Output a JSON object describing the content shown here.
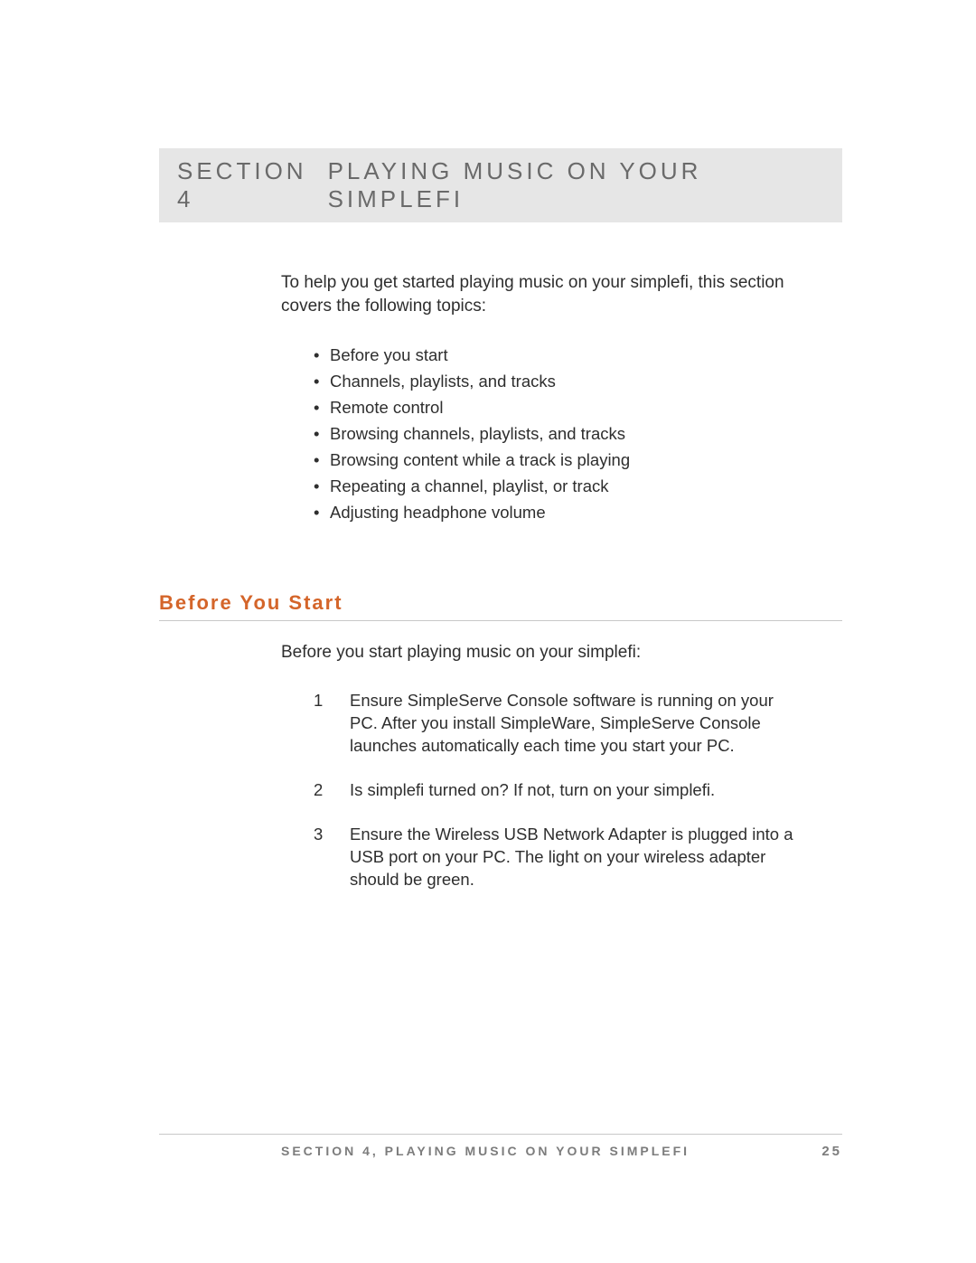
{
  "header": {
    "section_number": "SECTION 4",
    "section_title": "PLAYING MUSIC ON YOUR SIMPLEFI"
  },
  "intro": {
    "text": "To help you get started playing music on your simplefi, this section covers the following topics:",
    "topics": [
      "Before you start",
      "Channels, playlists, and tracks",
      "Remote control",
      "Browsing channels, playlists, and tracks",
      "Browsing content while a track is playing",
      "Repeating a channel, playlist, or track",
      "Adjusting headphone volume"
    ]
  },
  "subsection": {
    "title": "Before You Start",
    "intro": "Before you start playing music on your simplefi:",
    "steps": [
      {
        "num": "1",
        "text": "Ensure SimpleServe Console software is running on your PC.  After you install SimpleWare, SimpleServe Console launches automatically each time you start your PC."
      },
      {
        "num": "2",
        "text": "Is simplefi turned on?  If not, turn on your simplefi."
      },
      {
        "num": "3",
        "text": "Ensure the Wireless USB Network Adapter is plugged into a USB port on your PC.  The light on your wireless adapter should be green."
      }
    ]
  },
  "footer": {
    "text": "SECTION 4, PLAYING MUSIC ON YOUR SIMPLEFI",
    "page": "25"
  }
}
